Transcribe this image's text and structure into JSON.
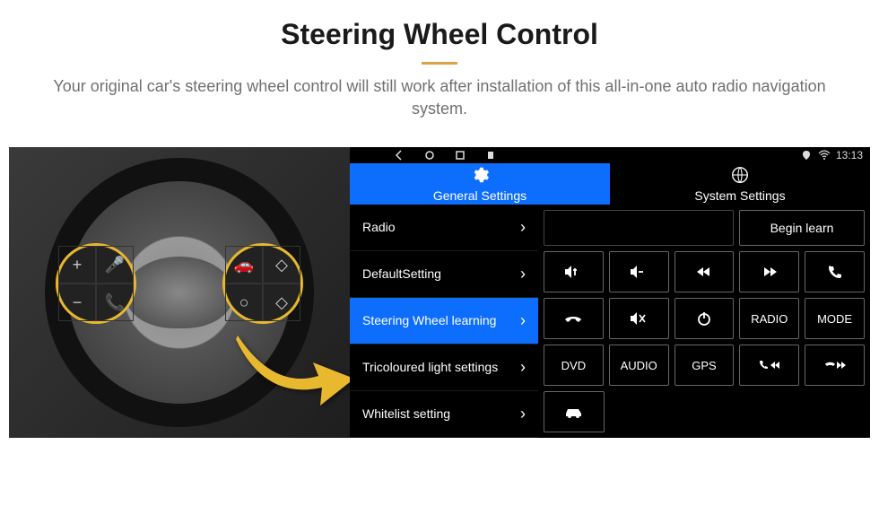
{
  "header": {
    "title": "Steering Wheel Control",
    "subtitle": "Your original car's steering wheel control will still work after installation of this all-in-one auto radio navigation system."
  },
  "statusbar": {
    "time": "13:13"
  },
  "tabs": {
    "general": "General Settings",
    "system": "System Settings"
  },
  "menu": {
    "radio": "Radio",
    "defaultSetting": "DefaultSetting",
    "swc": "Steering Wheel learning",
    "tricoloured": "Tricoloured light settings",
    "whitelist": "Whitelist setting"
  },
  "beginLearn": "Begin learn",
  "gridLabels": {
    "radio": "RADIO",
    "mode": "MODE",
    "dvd": "DVD",
    "audio": "AUDIO",
    "gps": "GPS"
  },
  "wheelButtons": {
    "left": [
      "+",
      "🎤",
      "−",
      "📞"
    ],
    "right": [
      "🚗",
      "◇",
      "○",
      "◇"
    ]
  }
}
